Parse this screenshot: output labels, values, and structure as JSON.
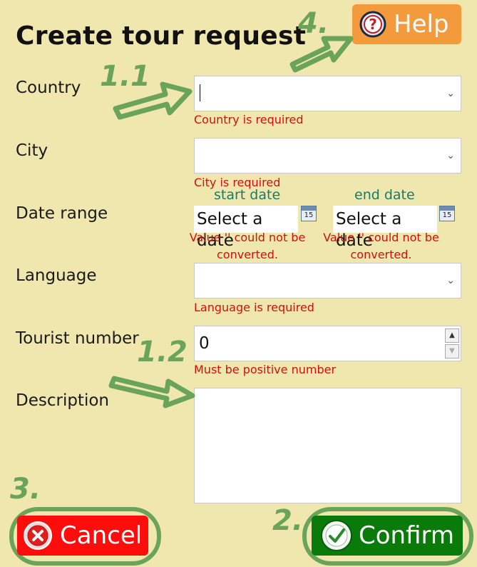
{
  "title": "Create tour request",
  "help": {
    "label": "Help",
    "icon": "question-icon"
  },
  "form": {
    "country": {
      "label": "Country",
      "error": "Country is required"
    },
    "city": {
      "label": "City",
      "error": "City is required"
    },
    "date_range": {
      "label": "Date range",
      "start_label": "start date",
      "end_label": "end date",
      "start_placeholder": "Select a date",
      "end_placeholder": "Select a date",
      "calendar_day": "15",
      "start_error_line1": "Value '' could not be",
      "start_error_line2": "converted.",
      "end_error_line1": "Value '' could not be",
      "end_error_line2": "converted."
    },
    "language": {
      "label": "Language",
      "error": "Language is required"
    },
    "tourist_number": {
      "label": "Tourist number",
      "value": "0",
      "error": "Must be positive number"
    },
    "description": {
      "label": "Description"
    }
  },
  "buttons": {
    "cancel": {
      "label": "Cancel",
      "icon": "x-circle-icon",
      "color": "#ff0d0d"
    },
    "confirm": {
      "label": "Confirm",
      "icon": "check-circle-icon",
      "color": "#0a7a0a"
    }
  },
  "annotations": {
    "a11": "1.1",
    "a12": "1.2",
    "a2": "2.",
    "a3": "3.",
    "a4": "4."
  },
  "colors": {
    "background": "#efe7ae",
    "error": "#d01010",
    "annotation": "#6aa35a",
    "help": "#f39a3d"
  }
}
